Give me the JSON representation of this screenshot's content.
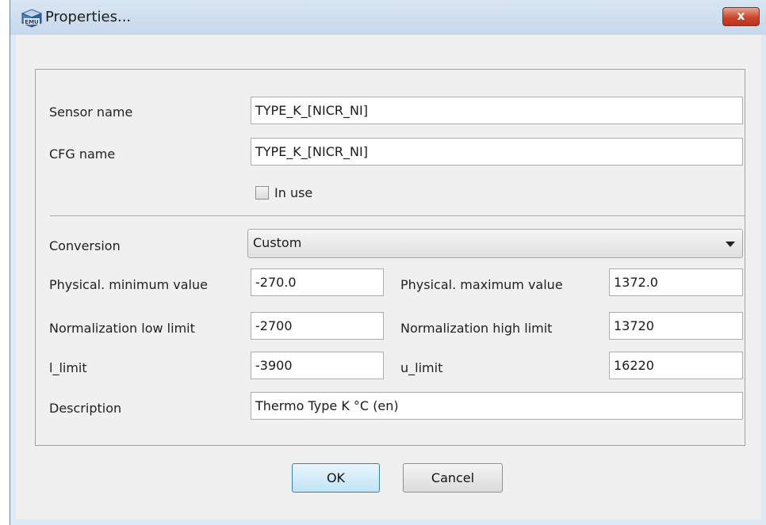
{
  "window": {
    "title": "Properties...",
    "close_label": "x"
  },
  "form": {
    "sensor_name_label": "Sensor name",
    "sensor_name_value": "TYPE_K_[NICR_NI]",
    "cfg_name_label": "CFG name",
    "cfg_name_value": "TYPE_K_[NICR_NI]",
    "in_use_label": "In use",
    "in_use_checked": false,
    "conversion_label": "Conversion",
    "conversion_value": "Custom",
    "phys_min_label": "Physical. minimum value",
    "phys_min_value": "-270.0",
    "phys_max_label": "Physical. maximum value",
    "phys_max_value": "1372.0",
    "norm_low_label": "Normalization low limit",
    "norm_low_value": "-2700",
    "norm_high_label": "Normalization high limit",
    "norm_high_value": "13720",
    "l_limit_label": "l_limit",
    "l_limit_value": "-3900",
    "u_limit_label": "u_limit",
    "u_limit_value": "16220",
    "description_label": "Description",
    "description_value": "Thermo Type K °C (en)"
  },
  "buttons": {
    "ok_label": "OK",
    "cancel_label": "Cancel"
  },
  "colors": {
    "close_button": "#c9452c",
    "title_bar": "#c6d8ec",
    "dialog_bg": "#f0f0f0"
  }
}
